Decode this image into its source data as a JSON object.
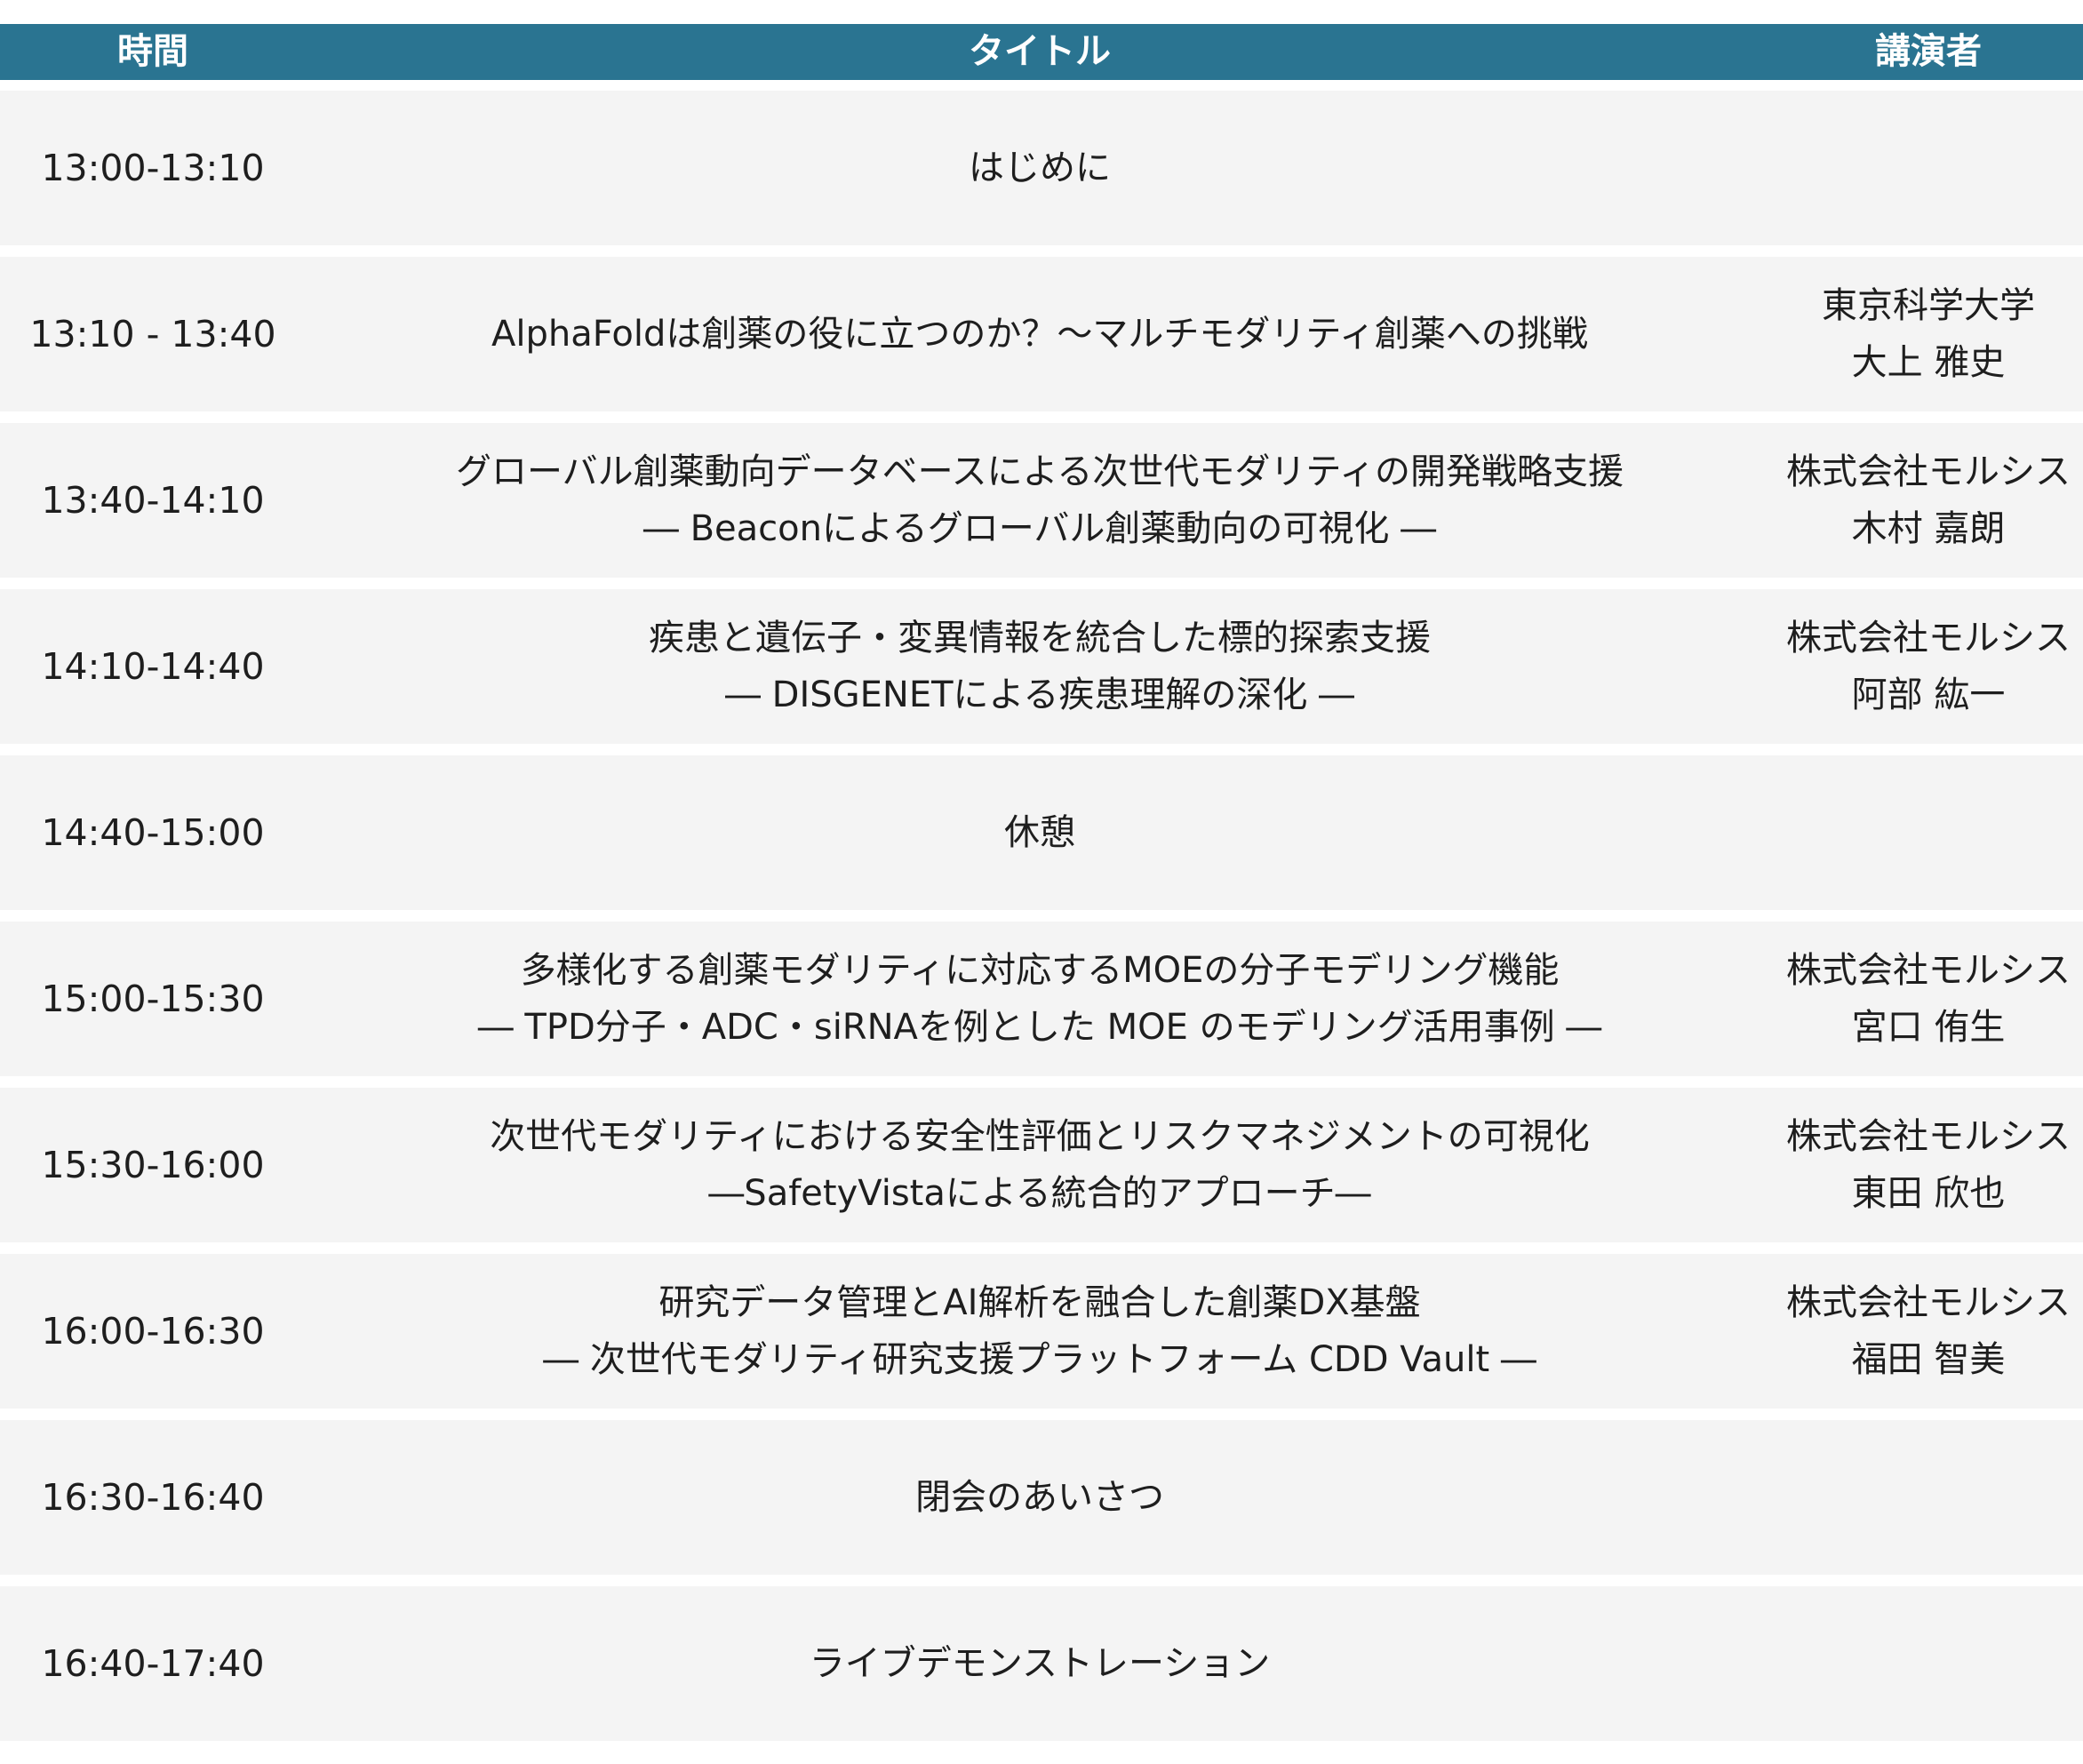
{
  "header": {
    "time": "時間",
    "title": "タイトル",
    "speaker": "講演者"
  },
  "rows": [
    {
      "time": "13:00-13:10",
      "title": [
        "はじめに",
        ""
      ],
      "speaker": [
        "",
        ""
      ]
    },
    {
      "time": "13:10 - 13:40",
      "title": [
        "AlphaFoldは創薬の役に立つのか？～マルチモダリティ創薬への挑戦",
        ""
      ],
      "speaker": [
        "東京科学大学",
        "大上 雅史"
      ]
    },
    {
      "time": "13:40-14:10",
      "title": [
        "グローバル創薬動向データベースによる次世代モダリティの開発戦略支援",
        "― Beaconによるグローバル創薬動向の可視化 ―"
      ],
      "speaker": [
        "株式会社モルシス",
        "木村 嘉朗"
      ]
    },
    {
      "time": "14:10-14:40",
      "title": [
        "疾患と遺伝子・変異情報を統合した標的探索支援",
        "― DISGENETによる疾患理解の深化 ―"
      ],
      "speaker": [
        "株式会社モルシス",
        "阿部 紘一"
      ]
    },
    {
      "time": "14:40-15:00",
      "title": [
        "休憩",
        ""
      ],
      "speaker": [
        "",
        ""
      ]
    },
    {
      "time": "15:00-15:30",
      "title": [
        "多様化する創薬モダリティに対応するMOEの分子モデリング機能",
        "― TPD分子・ADC・siRNAを例とした MOE のモデリング活用事例 ―"
      ],
      "speaker": [
        "株式会社モルシス",
        "宮口 侑生"
      ]
    },
    {
      "time": "15:30-16:00",
      "title": [
        "次世代モダリティにおける安全性評価とリスクマネジメントの可視化",
        "―SafetyVistaによる統合的アプローチ―"
      ],
      "speaker": [
        "株式会社モルシス",
        "東田 欣也"
      ]
    },
    {
      "time": "16:00-16:30",
      "title": [
        "研究データ管理とAI解析を融合した創薬DX基盤",
        "― 次世代モダリティ研究支援プラットフォーム CDD Vault ―"
      ],
      "speaker": [
        "株式会社モルシス",
        "福田 智美"
      ]
    },
    {
      "time": "16:30-16:40",
      "title": [
        "閉会のあいさつ",
        ""
      ],
      "speaker": [
        "",
        ""
      ]
    },
    {
      "time": "16:40-17:40",
      "title": [
        "ライブデモンストレーション",
        ""
      ],
      "speaker": [
        "",
        ""
      ]
    }
  ],
  "colors": {
    "header_bg": "#2a7491",
    "header_text": "#ffffff",
    "row_bg": "#f4f4f4",
    "text": "#1e1e1e"
  }
}
